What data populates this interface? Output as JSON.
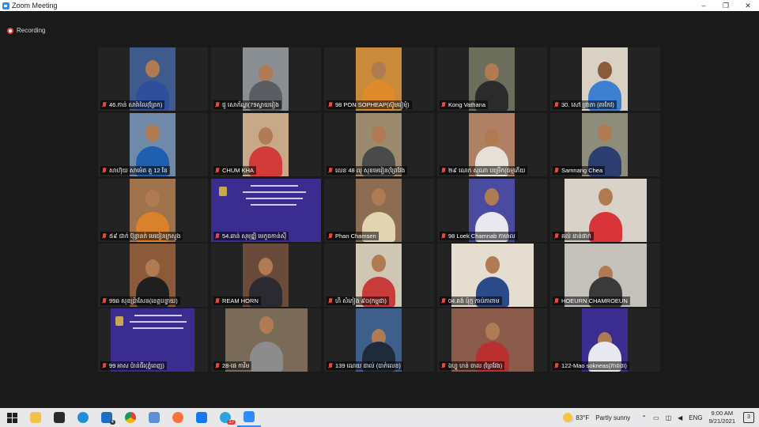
{
  "window": {
    "title": "Zoom Meeting",
    "minimize": "–",
    "restore": "❐",
    "close": "✕"
  },
  "recording": {
    "label": "Recording"
  },
  "participants": [
    "46.កាន់ សារ៉ាលៃ(ព្រែក)",
    "ជួ សោភ័ណ្ឌ(79ស្វាយរៀង",
    "98 PON SOPHEAP(ស៊ូមរៀមុំ)",
    "Kong Vathana",
    "30. សៅ ផ្រាភា (តាកែវ)",
    "សាហ៊ុយ សាម៉េត គួ 12 ខែ",
    "CHUM KHA",
    "លេខ 48 លុ សុខមេរៀន(ព្រៃវែង",
    "២៩ ណេក សុណា បម្រើក(ធម្មភើយ",
    "Samnang Chea",
    "៥៩ ជាក់ ប៊ុន្ធានក់ មេចៀនក្រសួង",
    "54.ឆាន់ សុមុឌ្ឍិ មេកួចកាន់ស៊ី",
    "Phan Chamsen",
    "98 Loek Chamnab កាមាល",
    "គល់ ដាន់ផាក់",
    "99ឆ សុខប្រ៉ាសែន(ខេត្តបន្ទាយ)",
    "REAM HORN",
    "ហិ សំភៀង ៩០(កម្ពុជា)",
    "04.គង់ ប៉ុក្ក កាប់ភាពាម",
    "HOEURN CHAMROEUN",
    "99 អាស ប៉ាន់ធីរ(ភ្នំពេញ)",
    "28-ផេ ការឹម",
    "139 ណេយ ដាល់ (បាក់លេខ)",
    "ឯហ្វូ ហន់ ចាល (ព្រៃវែង)",
    "122-Mao sokneas(ភាព៣)"
  ],
  "taskbar": {
    "weather_temp": "83°F",
    "weather_text": "Partly sunny",
    "language": "ENG",
    "time": "9:00 AM",
    "date": "9/21/2021",
    "notifications": "3",
    "mail_badge": "4",
    "telegram_badge": "17"
  },
  "colors": {
    "accent": "#2d8cff",
    "record": "#e8432f",
    "muted_mic": "#e5483a"
  }
}
